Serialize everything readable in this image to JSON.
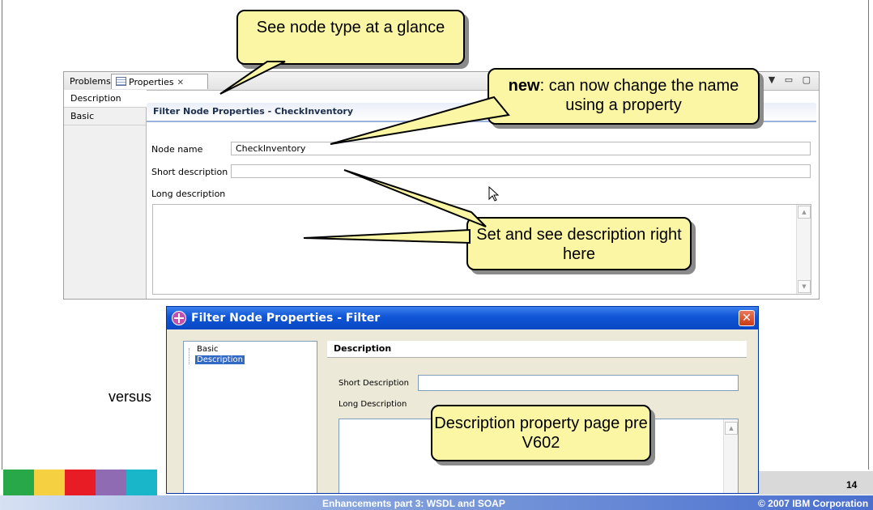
{
  "eclipse_view": {
    "tabs": [
      {
        "label": "Problems"
      },
      {
        "label": "Properties",
        "close": "✕"
      }
    ],
    "view_controls": "▼ ▭ ▢",
    "sections": [
      {
        "label": "Description"
      },
      {
        "label": "Basic"
      }
    ],
    "header": "Filter Node Properties - CheckInventory",
    "fields": {
      "node_name_label": "Node name",
      "node_name_value": "CheckInventory",
      "short_description_label": "Short description",
      "short_description_value": "",
      "long_description_label": "Long description"
    }
  },
  "old_dialog": {
    "title": "Filter Node Properties - Filter",
    "close": "✕",
    "tree_items": [
      {
        "label": "Basic"
      },
      {
        "label": "Description"
      }
    ],
    "panel_heading": "Description",
    "short_description_label": "Short Description",
    "long_description_label": "Long Description"
  },
  "callouts": {
    "node_type": "See node type at a glance",
    "new_bold": "new",
    "new_rest": ": can now change the name using a property",
    "set_description": "Set and see description right here",
    "pre_v602": "Description property page pre V602"
  },
  "versus": "versus",
  "footer": {
    "title": "Enhancements part 3: WSDL and SOAP",
    "copyright": "© 2007 IBM Corporation",
    "page_number": "14",
    "block_colors": [
      "#29a84a",
      "#f5d040",
      "#e81c24",
      "#8e6bb3",
      "#19b5c8"
    ]
  }
}
